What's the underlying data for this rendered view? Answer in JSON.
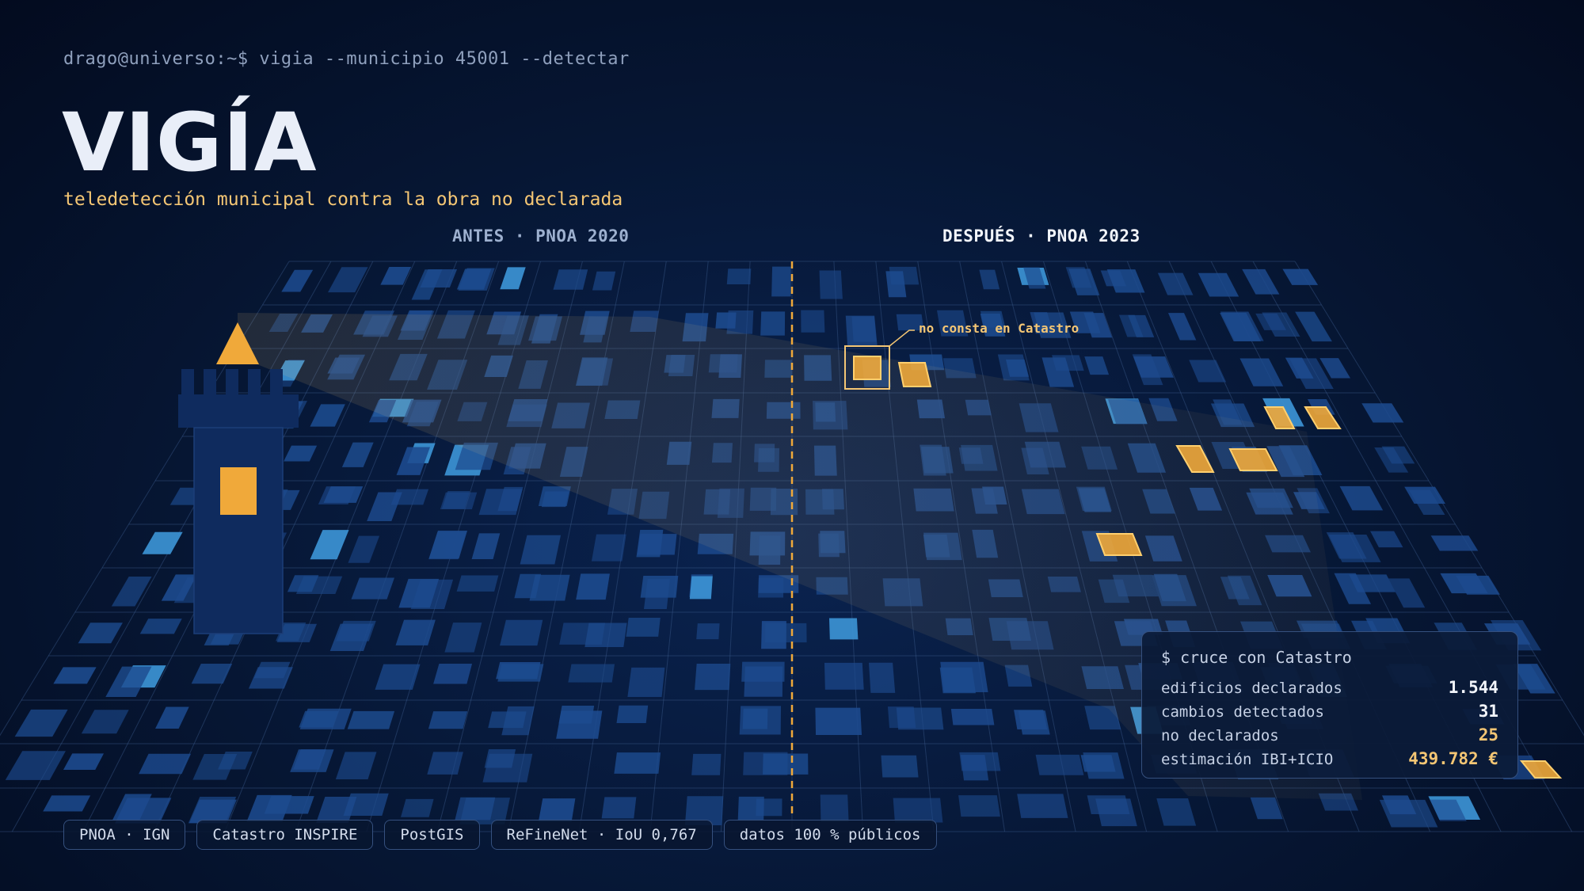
{
  "terminal": {
    "prompt": "drago@universo:~$ vigia --municipio 45001 --detectar"
  },
  "hero": {
    "title": "VIGÍA",
    "subtitle": "teledetección municipal contra la obra no declarada"
  },
  "comparison": {
    "before_label": "ANTES · PNOA 2020",
    "after_label": "DESPUÉS · PNOA 2023",
    "annotation": "no consta en Catastro"
  },
  "stats": {
    "heading": "$ cruce con Catastro",
    "rows": [
      {
        "label": "edificios declarados",
        "value": "1.544"
      },
      {
        "label": "cambios detectados",
        "value": "31"
      },
      {
        "label": "no declarados",
        "value": "25"
      },
      {
        "label": "estimación IBI+ICIO",
        "value": "439.782 €"
      }
    ]
  },
  "chips": [
    "PNOA · IGN",
    "Catastro INSPIRE",
    "PostGIS",
    "ReFineNet · IoU 0,767",
    "datos 100 % públicos"
  ],
  "icons": {
    "watchtower": "watchtower-icon"
  },
  "colors": {
    "accent": "#f4c674",
    "highlight": "#f0a93a",
    "building": "#1d4b8f",
    "building_cyan": "#3a8fd0",
    "tower": "#0f2b5e",
    "background": "#061633"
  }
}
